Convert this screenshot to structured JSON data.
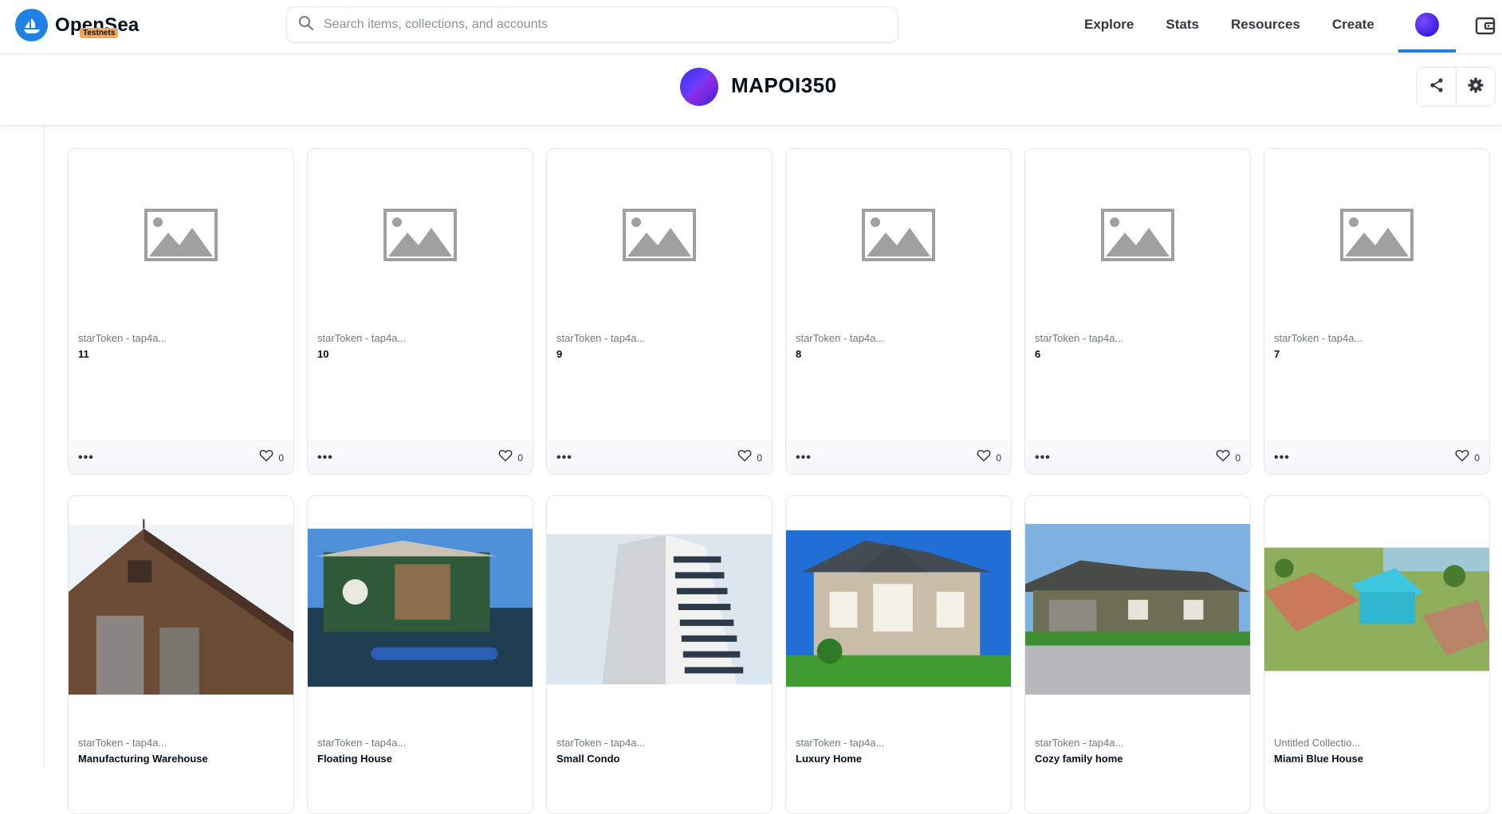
{
  "brand": {
    "name": "OpenSea",
    "badge": "Testnets"
  },
  "search": {
    "placeholder": "Search items, collections, and accounts"
  },
  "nav": {
    "items": [
      "Explore",
      "Stats",
      "Resources",
      "Create"
    ]
  },
  "collection": {
    "title": "MAPOI350"
  },
  "cards_row1": [
    {
      "collection": "starToken - tap4a...",
      "name": "11",
      "likes": "0"
    },
    {
      "collection": "starToken - tap4a...",
      "name": "10",
      "likes": "0"
    },
    {
      "collection": "starToken - tap4a...",
      "name": "9",
      "likes": "0"
    },
    {
      "collection": "starToken - tap4a...",
      "name": "8",
      "likes": "0"
    },
    {
      "collection": "starToken - tap4a...",
      "name": "6",
      "likes": "0"
    },
    {
      "collection": "starToken - tap4a...",
      "name": "7",
      "likes": "0"
    }
  ],
  "cards_row2": [
    {
      "collection": "starToken - tap4a...",
      "name": "Manufacturing Warehouse"
    },
    {
      "collection": "starToken - tap4a...",
      "name": "Floating House"
    },
    {
      "collection": "starToken - tap4a...",
      "name": "Small Condo"
    },
    {
      "collection": "starToken - tap4a...",
      "name": "Luxury Home"
    },
    {
      "collection": "starToken - tap4a...",
      "name": "Cozy family home"
    },
    {
      "collection": "Untitled Collectio...",
      "name": "Miami Blue House"
    }
  ],
  "colors": {
    "accent": "#2081e2",
    "badge": "#f2a660"
  }
}
